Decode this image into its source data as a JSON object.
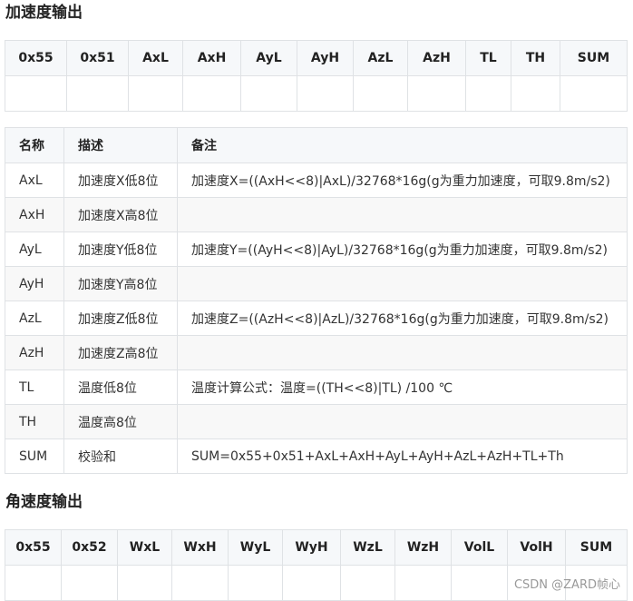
{
  "section1": {
    "title": "加速度输出",
    "headers": [
      "0x55",
      "0x51",
      "AxL",
      "AxH",
      "AyL",
      "AyH",
      "AzL",
      "AzH",
      "TL",
      "TH",
      "SUM"
    ]
  },
  "desc_table": {
    "headers": [
      "名称",
      "描述",
      "备注"
    ],
    "rows": [
      {
        "name": "AxL",
        "desc": "加速度X低8位",
        "note": "加速度X=((AxH<<8)|AxL)/32768*16g(g为重力加速度，可取9.8m/s2)"
      },
      {
        "name": "AxH",
        "desc": "加速度X高8位",
        "note": ""
      },
      {
        "name": "AyL",
        "desc": "加速度Y低8位",
        "note": "加速度Y=((AyH<<8)|AyL)/32768*16g(g为重力加速度，可取9.8m/s2)"
      },
      {
        "name": "AyH",
        "desc": "加速度Y高8位",
        "note": ""
      },
      {
        "name": "AzL",
        "desc": "加速度Z低8位",
        "note": "加速度Z=((AzH<<8)|AzL)/32768*16g(g为重力加速度，可取9.8m/s2)"
      },
      {
        "name": "AzH",
        "desc": "加速度Z高8位",
        "note": ""
      },
      {
        "name": "TL",
        "desc": "温度低8位",
        "note": "温度计算公式：温度=((TH<<8)|TL) /100 ℃"
      },
      {
        "name": "TH",
        "desc": "温度高8位",
        "note": ""
      },
      {
        "name": "SUM",
        "desc": "校验和",
        "note": "SUM=0x55+0x51+AxL+AxH+AyL+AyH+AzL+AzH+TL+Th"
      }
    ]
  },
  "section2": {
    "title": "角速度输出",
    "headers": [
      "0x55",
      "0x52",
      "WxL",
      "WxH",
      "WyL",
      "WyH",
      "WzL",
      "WzH",
      "VolL",
      "VolH",
      "SUM"
    ]
  },
  "watermark": "CSDN @ZARD帧心"
}
